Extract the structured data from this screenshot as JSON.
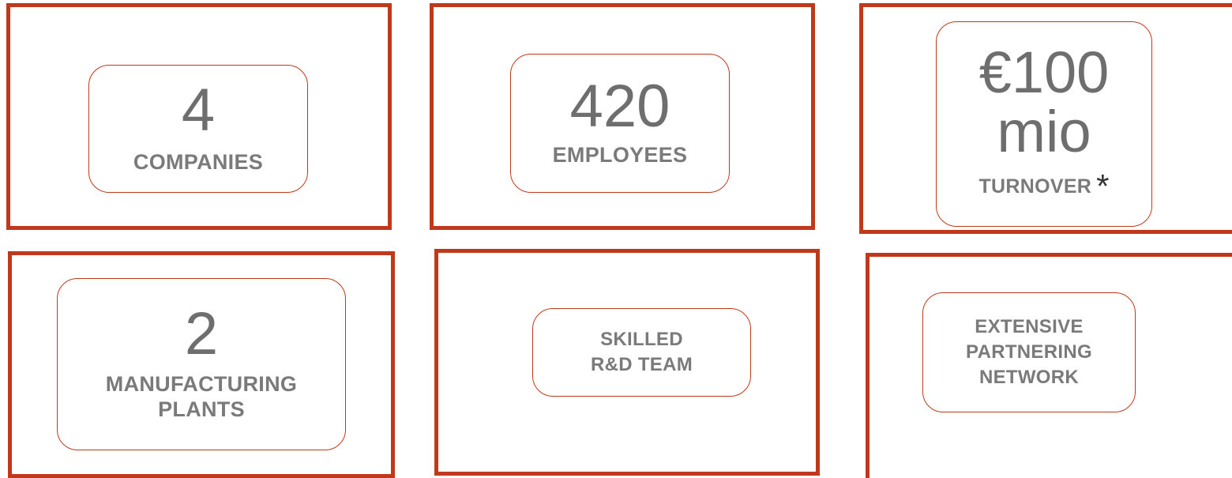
{
  "cards": {
    "companies": {
      "value": "4",
      "label": "COMPANIES"
    },
    "employees": {
      "value": "420",
      "label": "EMPLOYEES"
    },
    "turnover": {
      "value_line1": "€100",
      "value_line2": "mio",
      "label": "TURNOVER",
      "note_mark": "*"
    },
    "plants": {
      "value": "2",
      "label_line1": "MANUFACTURING",
      "label_line2": "PLANTS"
    },
    "rd_team": {
      "label_line1": "SKILLED",
      "label_line2": "R&D TEAM"
    },
    "network": {
      "label_line1": "EXTENSIVE",
      "label_line2": "PARTNERING",
      "label_line3": "NETWORK"
    }
  },
  "colors": {
    "accent": "#c0391b",
    "text": "#7a7a7a"
  }
}
